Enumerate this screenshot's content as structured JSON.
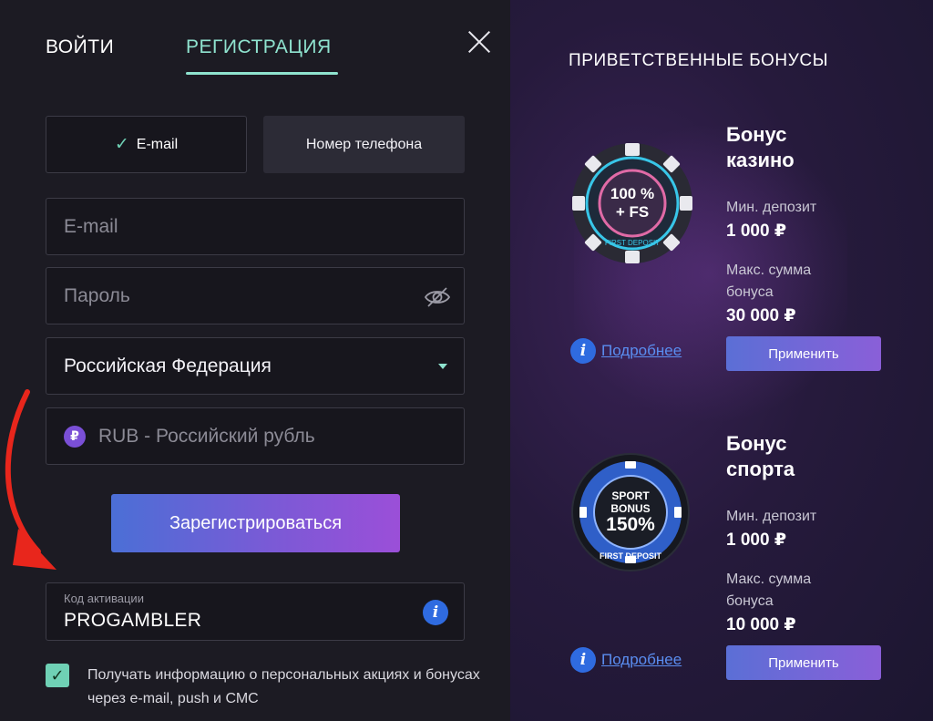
{
  "tabs": {
    "login": "ВОЙТИ",
    "register": "РЕГИСТРАЦИЯ"
  },
  "method": {
    "email": "E-mail",
    "phone": "Номер телефона"
  },
  "fields": {
    "email_placeholder": "E-mail",
    "password_placeholder": "Пароль",
    "country": "Российская Федерация",
    "currency": "RUB - Российский рубль",
    "currency_symbol": "₽"
  },
  "register_button": "Зарегистрироваться",
  "promo": {
    "label": "Код активации",
    "value": "PROGAMBLER"
  },
  "consent": {
    "checked": true,
    "text": "Получать информацию о персональных акциях и бонусах через e-mail, push и СМС"
  },
  "bonuses": {
    "title": "ПРИВЕТСТВЕННЫЕ БОНУСЫ",
    "items": [
      {
        "name_line1": "Бонус",
        "name_line2": "казино",
        "chip_line1": "100 %",
        "chip_line2": "+ FS",
        "chip_ring": "FIRST DEPOSIT",
        "min_label": "Мин. депозит",
        "min_value": "1 000 ₽",
        "max_label_line1": "Макс. сумма",
        "max_label_line2": "бонуса",
        "max_value": "30 000 ₽",
        "apply": "Применить",
        "more": "Подробнее"
      },
      {
        "name_line1": "Бонус",
        "name_line2": "спорта",
        "chip_line1": "SPORT",
        "chip_line2": "BONUS",
        "chip_line3": "150%",
        "chip_ring": "FIRST DEPOSIT",
        "min_label": "Мин. депозит",
        "min_value": "1 000 ₽",
        "max_label_line1": "Макс. сумма",
        "max_label_line2": "бонуса",
        "max_value": "10 000 ₽",
        "apply": "Применить",
        "more": "Подробнее"
      }
    ]
  },
  "colors": {
    "accent": "#8fe3cf",
    "button_from": "#4b6fd6",
    "button_to": "#9b4fd8",
    "annotation_arrow": "#e8261c"
  }
}
